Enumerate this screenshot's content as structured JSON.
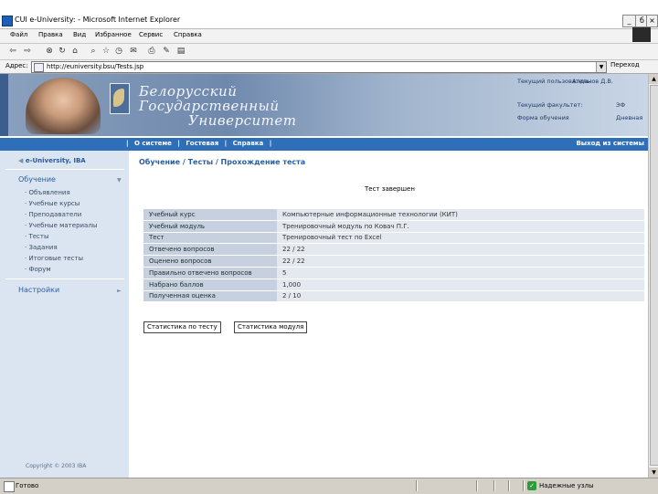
{
  "window": {
    "title": "CUI e-University: - Microsoft Internet Explorer",
    "min": "_",
    "max": "б",
    "close": "×"
  },
  "menu": [
    "Файл",
    "Правка",
    "Вид",
    "Избранное",
    "Сервис",
    "Справка"
  ],
  "address": {
    "label": "Адрес:",
    "url": "http://euniversity.bsu/Tests.jsp",
    "go": "Переход"
  },
  "banner": {
    "university": [
      "Белорусский",
      "Государственный",
      "Университет"
    ],
    "user": [
      {
        "label": "Текущий пользователь:",
        "value": "Алданов Д.В."
      },
      {
        "label": "Текущий факультет:",
        "value": "ЭФ"
      },
      {
        "label": "Форма обучения",
        "value": "Дневная"
      }
    ]
  },
  "nav": {
    "items": [
      "О системе",
      "Гостевая",
      "Справка"
    ],
    "logout": "Выход из системы"
  },
  "sidebar": {
    "logo": "e-University, IBA",
    "section1": "Обучение",
    "items": [
      "Объявления",
      "Учебные курсы",
      "Преподаватели",
      "Учебные материалы",
      "Тесты",
      "Задания",
      "Итоговые тесты",
      "Форум"
    ],
    "section2": "Настройки",
    "copyright": "Copyright © 2003 IBA"
  },
  "breadcrumb": "Обучение / Тесты / Прохождение теста",
  "status_message": "Тест завершен",
  "results": [
    {
      "label": "Учебный курс",
      "value": "Компьютерные информационные технологии (КИТ)"
    },
    {
      "label": "Учебный модуль",
      "value": "Тренировочный модуль по Ковач П.Г."
    },
    {
      "label": "Тест",
      "value": "Тренировочный тест по Excel"
    },
    {
      "label": "Отвечено вопросов",
      "value": "22 / 22"
    },
    {
      "label": "Оценено вопросов",
      "value": "22 / 22"
    },
    {
      "label": "Правильно отвечено вопросов",
      "value": "5"
    },
    {
      "label": "Набрано баллов",
      "value": "1,000"
    },
    {
      "label": "Полученная оценка",
      "value": "2 / 10"
    }
  ],
  "buttons": {
    "stats_test": "Статистика по тесту",
    "stats_module": "Статистика модуля"
  },
  "statusbar": {
    "text": "Готово",
    "zone": "Надежные узлы"
  }
}
